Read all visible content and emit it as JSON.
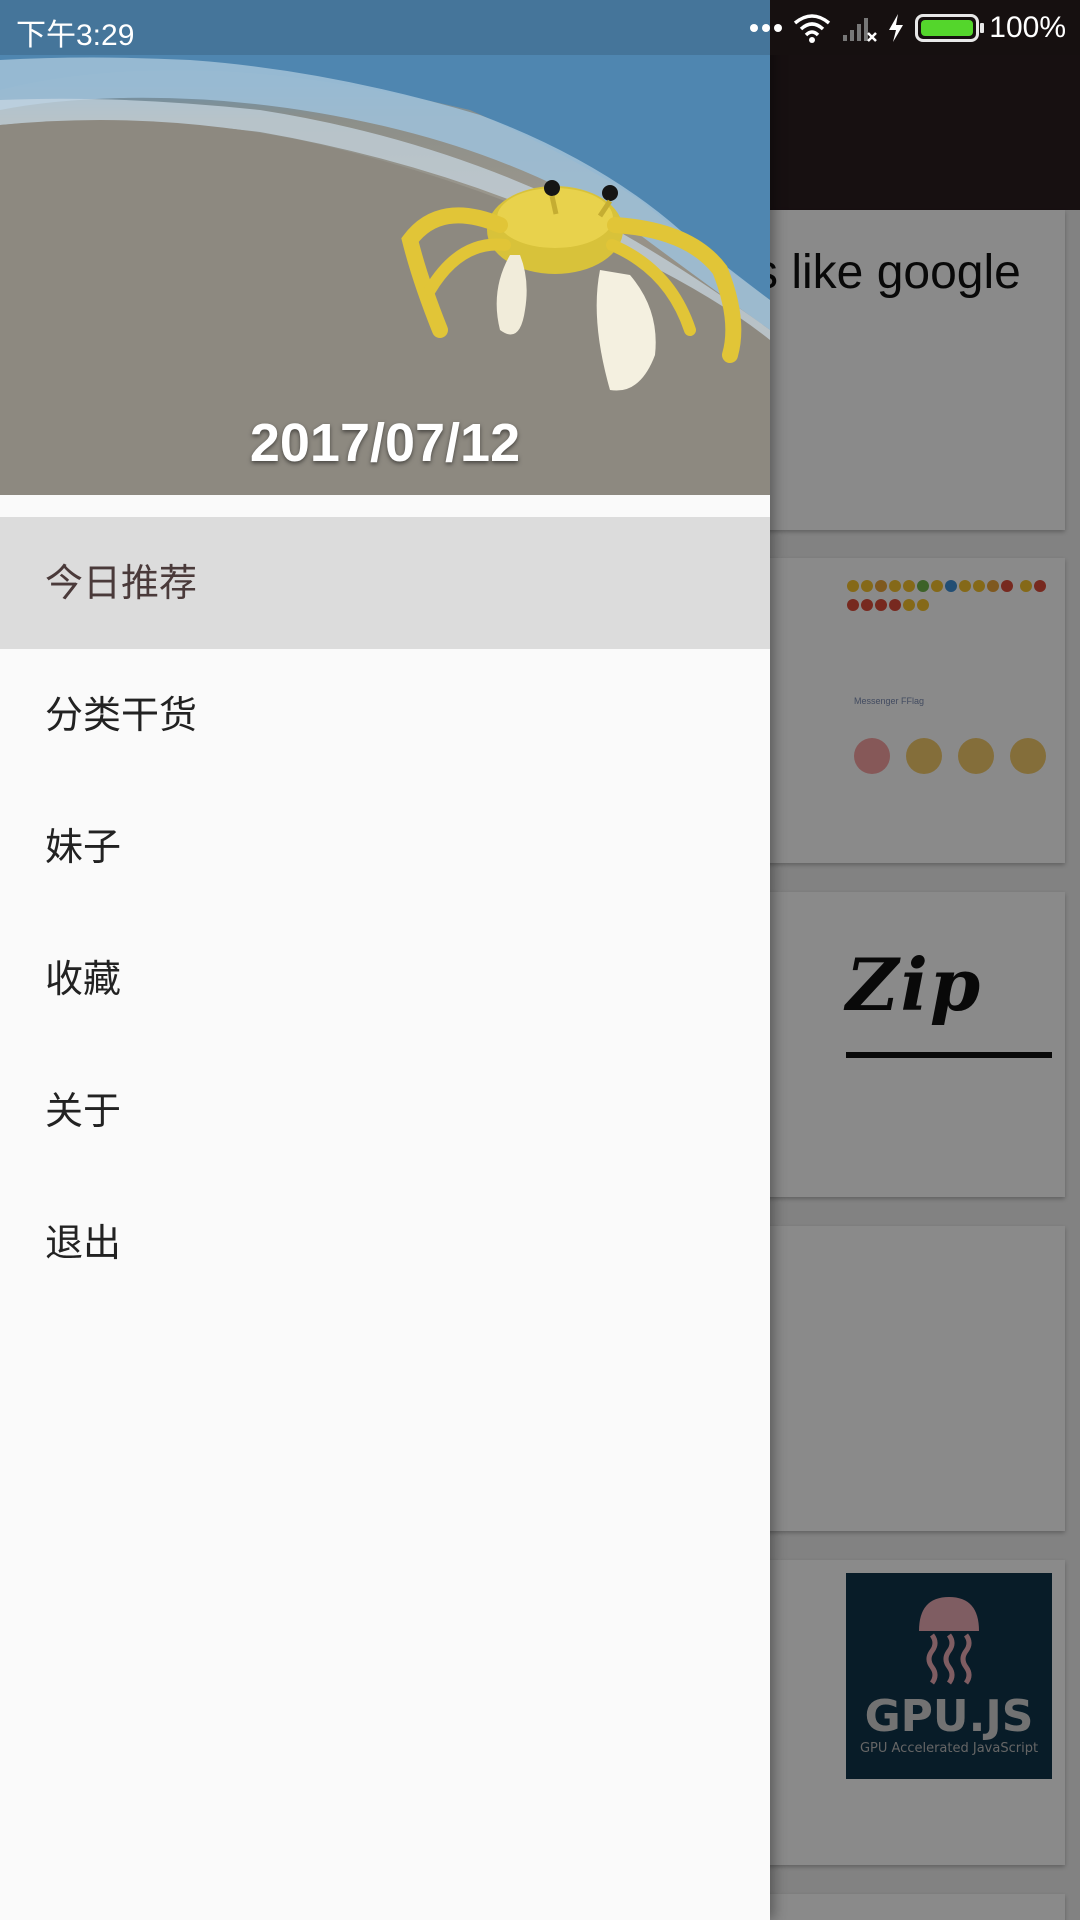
{
  "status_bar": {
    "time": "下午3:29",
    "battery_text": "100%",
    "battery_level": 1.0,
    "icons": [
      "more-dots-icon",
      "wifi-icon",
      "signal-icon",
      "charging-icon",
      "battery-icon"
    ]
  },
  "drawer": {
    "header_date": "2017/07/12",
    "header_image": "crab-on-beach",
    "items": [
      {
        "label": "今日推荐",
        "active": true
      },
      {
        "label": "分类干货",
        "active": false
      },
      {
        "label": "妹子",
        "active": false
      },
      {
        "label": "收藏",
        "active": false
      },
      {
        "label": "关于",
        "active": false
      },
      {
        "label": "退出",
        "active": false
      }
    ]
  },
  "background": {
    "card1_text": "s like google",
    "emoji_bar_text": "Messenger FFlag",
    "zip_text": "Zip",
    "gpu_title": "GPU.JS",
    "gpu_subtitle": "GPU Accelerated JavaScript"
  },
  "colors": {
    "toolbar": "#2b1e20",
    "drawer_bg": "#fafafa",
    "active_item_bg": "#dcdcdc",
    "battery_fill": "#54d62c"
  }
}
